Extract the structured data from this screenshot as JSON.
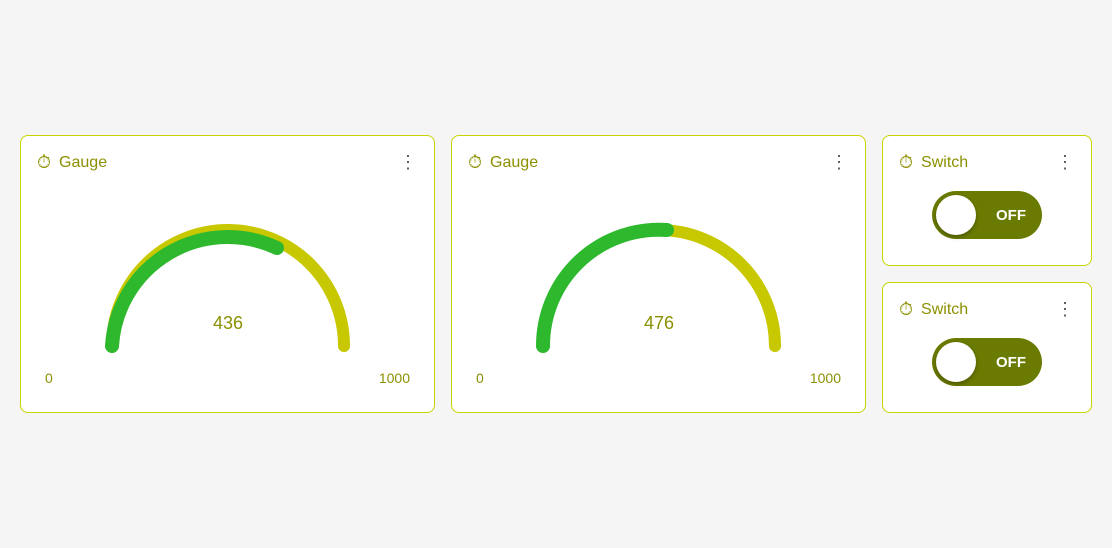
{
  "gauge1": {
    "title": "Gauge",
    "value": 436,
    "min": 0,
    "max": 1000,
    "fill_ratio": 0.436,
    "accent_color": "#2eb82e",
    "track_color": "#c8c800"
  },
  "gauge2": {
    "title": "Gauge",
    "value": 476,
    "min": 0,
    "max": 1000,
    "fill_ratio": 0.476,
    "accent_color": "#2eb82e",
    "track_color": "#c8c800"
  },
  "switch1": {
    "title": "Switch",
    "state": "OFF"
  },
  "switch2": {
    "title": "Switch",
    "state": "OFF"
  },
  "icons": {
    "history": "⏱",
    "menu": "⋮"
  }
}
